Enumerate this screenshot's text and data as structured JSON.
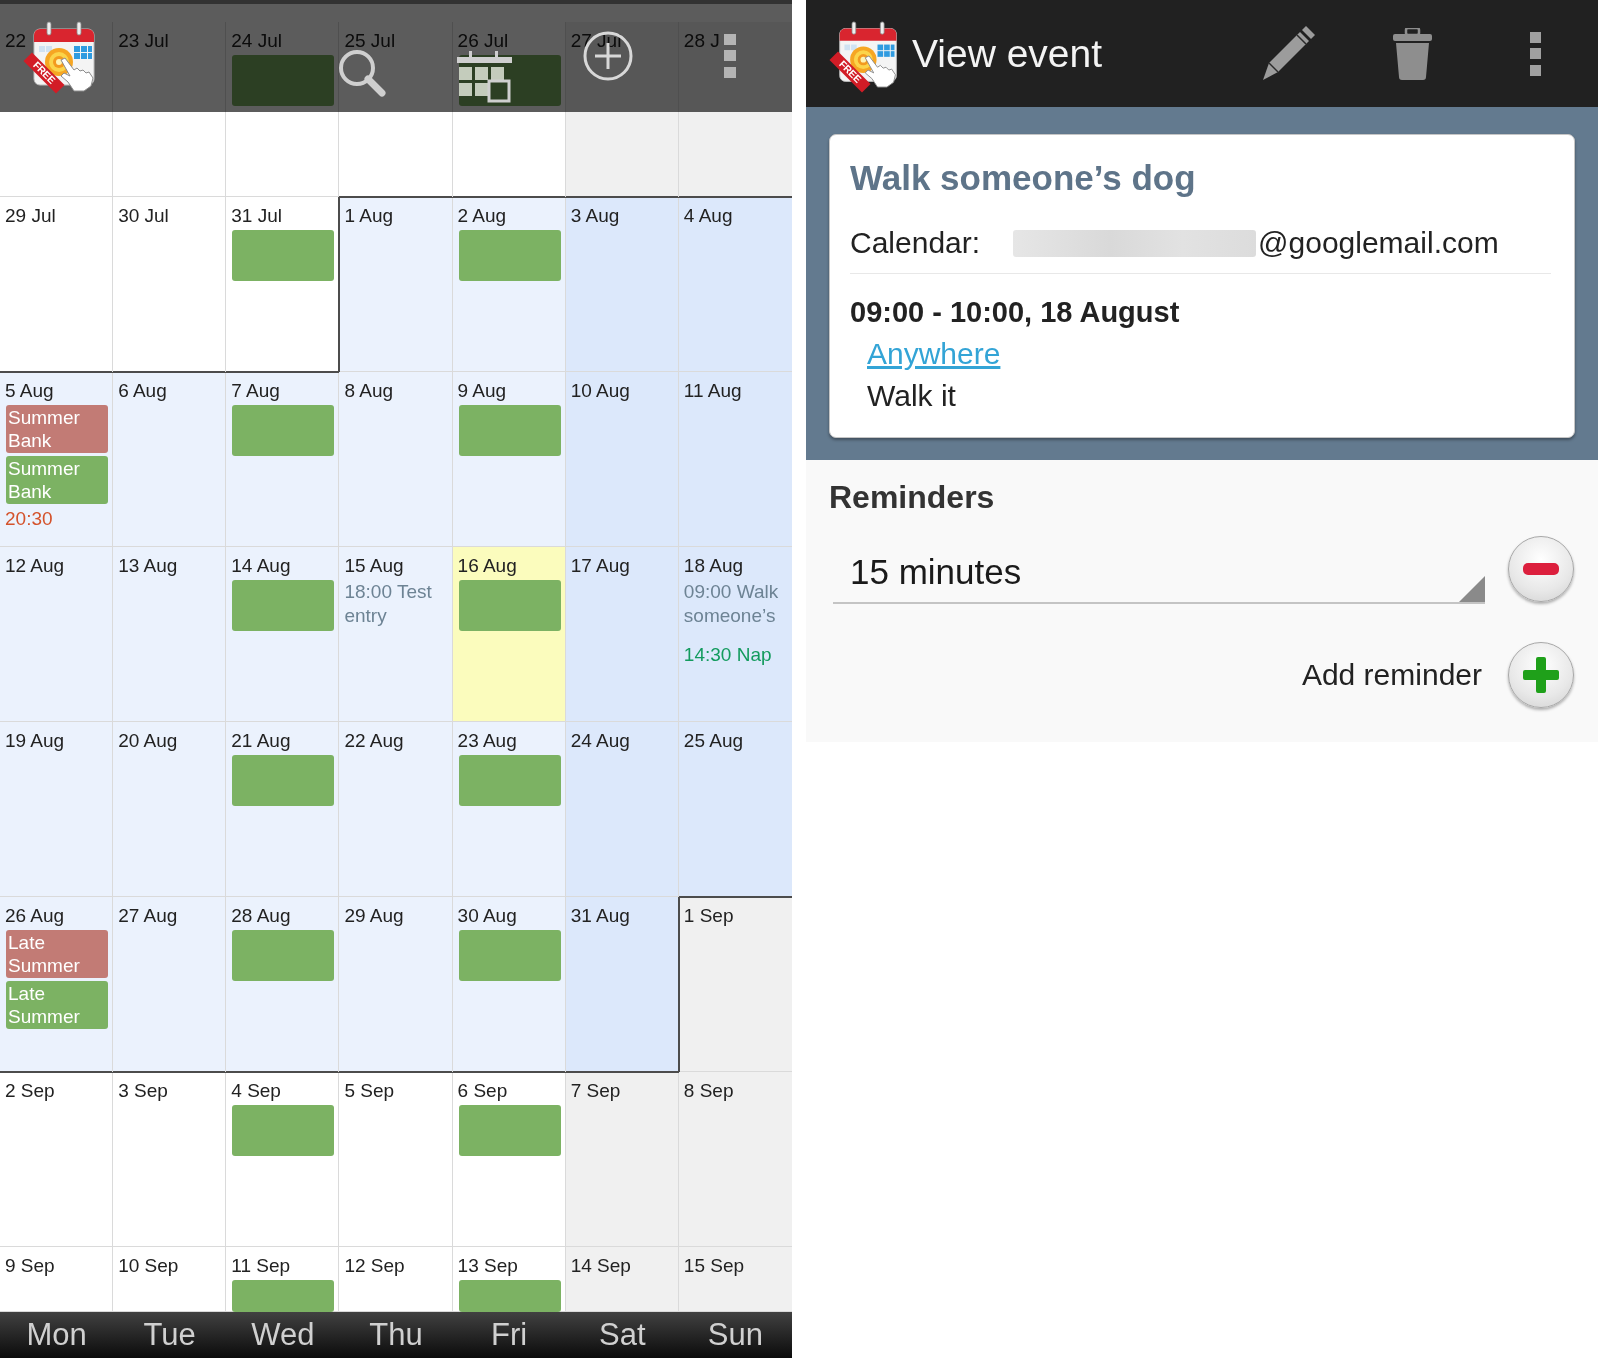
{
  "calendar": {
    "app_bar": {
      "logo_badge": "FREE"
    },
    "weekdays": [
      {
        "label": "Mon",
        "weekend": false
      },
      {
        "label": "Tue",
        "weekend": false
      },
      {
        "label": "Wed",
        "weekend": false
      },
      {
        "label": "Thu",
        "weekend": false
      },
      {
        "label": "Fri",
        "weekend": false
      },
      {
        "label": "Sat",
        "weekend": true
      },
      {
        "label": "Sun",
        "weekend": true
      }
    ],
    "weeks": [
      {
        "days": [
          {
            "date": "22",
            "in_month": false,
            "today": false
          },
          {
            "date": "23 Jul",
            "in_month": false,
            "today": false
          },
          {
            "date": "24 Jul",
            "in_month": false,
            "today": false,
            "events": [
              {
                "kind": "block",
                "color": "#2c3f23"
              }
            ]
          },
          {
            "date": "25 Jul",
            "in_month": false,
            "today": false
          },
          {
            "date": "26 Jul",
            "in_month": false,
            "today": false,
            "events": [
              {
                "kind": "block",
                "color": "#2c3f23"
              }
            ]
          },
          {
            "date": "27 Jul",
            "in_month": false,
            "today": false
          },
          {
            "date": "28 J",
            "in_month": false,
            "today": false
          }
        ]
      },
      {
        "days": [
          {
            "date": "29 Jul",
            "in_month": false,
            "today": false
          },
          {
            "date": "30 Jul",
            "in_month": false,
            "today": false
          },
          {
            "date": "31 Jul",
            "in_month": false,
            "today": false,
            "events": [
              {
                "kind": "block",
                "color": "#7cb263"
              }
            ]
          },
          {
            "date": "1 Aug",
            "in_month": true,
            "today": false
          },
          {
            "date": "2 Aug",
            "in_month": true,
            "today": false,
            "events": [
              {
                "kind": "block",
                "color": "#7cb263"
              }
            ]
          },
          {
            "date": "3 Aug",
            "in_month": true,
            "today": false
          },
          {
            "date": "4 Aug",
            "in_month": true,
            "today": false
          }
        ]
      },
      {
        "days": [
          {
            "date": "5 Aug",
            "in_month": true,
            "today": false,
            "events": [
              {
                "kind": "block",
                "color": "#c27b75",
                "label": "Summer Bank"
              },
              {
                "kind": "block",
                "color": "#7cb263",
                "label": "Summer Bank"
              },
              {
                "kind": "text",
                "color": "#d4532c",
                "label": "20:30"
              }
            ]
          },
          {
            "date": "6 Aug",
            "in_month": true,
            "today": false
          },
          {
            "date": "7 Aug",
            "in_month": true,
            "today": false,
            "events": [
              {
                "kind": "block",
                "color": "#7cb263"
              }
            ]
          },
          {
            "date": "8 Aug",
            "in_month": true,
            "today": false
          },
          {
            "date": "9 Aug",
            "in_month": true,
            "today": false,
            "events": [
              {
                "kind": "block",
                "color": "#7cb263"
              }
            ]
          },
          {
            "date": "10 Aug",
            "in_month": true,
            "today": false
          },
          {
            "date": "11 Aug",
            "in_month": true,
            "today": false
          }
        ]
      },
      {
        "days": [
          {
            "date": "12 Aug",
            "in_month": true,
            "today": false
          },
          {
            "date": "13 Aug",
            "in_month": true,
            "today": false
          },
          {
            "date": "14 Aug",
            "in_month": true,
            "today": false,
            "events": [
              {
                "kind": "block",
                "color": "#7cb263"
              }
            ]
          },
          {
            "date": "15 Aug",
            "in_month": true,
            "today": false,
            "events": [
              {
                "kind": "text",
                "color": "#6d8394",
                "label": "18:00 Test entry"
              }
            ]
          },
          {
            "date": "16 Aug",
            "in_month": true,
            "today": true,
            "events": [
              {
                "kind": "block",
                "color": "#7cb263"
              }
            ]
          },
          {
            "date": "17 Aug",
            "in_month": true,
            "today": false
          },
          {
            "date": "18 Aug",
            "in_month": true,
            "today": false,
            "events": [
              {
                "kind": "text",
                "color": "#6d8394",
                "label": "09:00 Walk someone’s"
              },
              {
                "kind": "text",
                "color": "#139b5e",
                "label": "14:30 Nap"
              }
            ]
          }
        ]
      },
      {
        "days": [
          {
            "date": "19 Aug",
            "in_month": true,
            "today": false
          },
          {
            "date": "20 Aug",
            "in_month": true,
            "today": false
          },
          {
            "date": "21 Aug",
            "in_month": true,
            "today": false,
            "events": [
              {
                "kind": "block",
                "color": "#7cb263"
              }
            ]
          },
          {
            "date": "22 Aug",
            "in_month": true,
            "today": false
          },
          {
            "date": "23 Aug",
            "in_month": true,
            "today": false,
            "events": [
              {
                "kind": "block",
                "color": "#7cb263"
              }
            ]
          },
          {
            "date": "24 Aug",
            "in_month": true,
            "today": false
          },
          {
            "date": "25 Aug",
            "in_month": true,
            "today": false
          }
        ]
      },
      {
        "days": [
          {
            "date": "26 Aug",
            "in_month": true,
            "today": false,
            "events": [
              {
                "kind": "block",
                "color": "#c27b75",
                "label": "Late Summer"
              },
              {
                "kind": "block",
                "color": "#7cb263",
                "label": "Late Summer"
              }
            ]
          },
          {
            "date": "27 Aug",
            "in_month": true,
            "today": false
          },
          {
            "date": "28 Aug",
            "in_month": true,
            "today": false,
            "events": [
              {
                "kind": "block",
                "color": "#7cb263"
              }
            ]
          },
          {
            "date": "29 Aug",
            "in_month": true,
            "today": false
          },
          {
            "date": "30 Aug",
            "in_month": true,
            "today": false,
            "events": [
              {
                "kind": "block",
                "color": "#7cb263"
              }
            ]
          },
          {
            "date": "31 Aug",
            "in_month": true,
            "today": false
          },
          {
            "date": "1 Sep",
            "in_month": false,
            "today": false
          }
        ]
      },
      {
        "days": [
          {
            "date": "2 Sep",
            "in_month": false,
            "today": false
          },
          {
            "date": "3 Sep",
            "in_month": false,
            "today": false
          },
          {
            "date": "4 Sep",
            "in_month": false,
            "today": false,
            "events": [
              {
                "kind": "block",
                "color": "#7cb263"
              }
            ]
          },
          {
            "date": "5 Sep",
            "in_month": false,
            "today": false
          },
          {
            "date": "6 Sep",
            "in_month": false,
            "today": false,
            "events": [
              {
                "kind": "block",
                "color": "#7cb263"
              }
            ]
          },
          {
            "date": "7 Sep",
            "in_month": false,
            "today": false
          },
          {
            "date": "8 Sep",
            "in_month": false,
            "today": false
          }
        ]
      },
      {
        "days": [
          {
            "date": "9 Sep",
            "in_month": false,
            "today": false
          },
          {
            "date": "10 Sep",
            "in_month": false,
            "today": false
          },
          {
            "date": "11 Sep",
            "in_month": false,
            "today": false,
            "events": [
              {
                "kind": "block",
                "color": "#7cb263"
              }
            ]
          },
          {
            "date": "12 Sep",
            "in_month": false,
            "today": false
          },
          {
            "date": "13 Sep",
            "in_month": false,
            "today": false,
            "events": [
              {
                "kind": "block",
                "color": "#7cb263"
              }
            ]
          },
          {
            "date": "14 Sep",
            "in_month": false,
            "today": false
          },
          {
            "date": "15 Sep",
            "in_month": false,
            "today": false
          }
        ]
      }
    ]
  },
  "event_view": {
    "header": {
      "logo_badge": "FREE",
      "title": "View event"
    },
    "event": {
      "title": "Walk someone’s dog",
      "calendar_label": "Calendar:",
      "calendar_blurred": true,
      "calendar_value": "@googlemail.com",
      "time": "09:00 - 10:00, 18 August",
      "location": "Anywhere",
      "description": "Walk it"
    },
    "reminders": {
      "heading": "Reminders",
      "items": [
        {
          "value": "15 minutes"
        }
      ],
      "add_label": "Add reminder"
    }
  }
}
